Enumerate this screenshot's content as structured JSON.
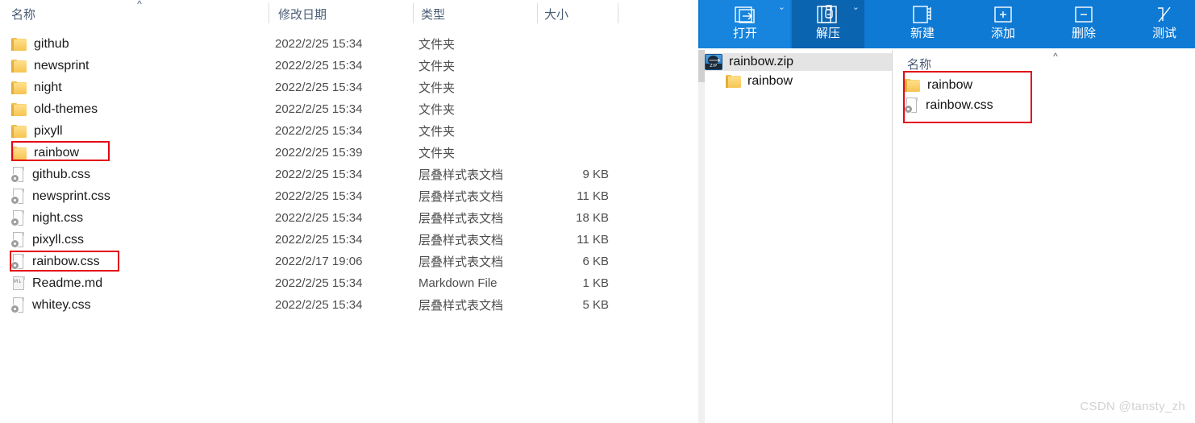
{
  "explorer": {
    "columns": [
      {
        "key": "name",
        "label": "名称"
      },
      {
        "key": "date",
        "label": "修改日期"
      },
      {
        "key": "type",
        "label": "类型"
      },
      {
        "key": "size",
        "label": "大小"
      }
    ],
    "sort_indicator": "chevron-up-icon",
    "rows": [
      {
        "icon": "folder-icon",
        "name": "github",
        "date": "2022/2/25 15:34",
        "type": "文件夹",
        "size": ""
      },
      {
        "icon": "folder-icon",
        "name": "newsprint",
        "date": "2022/2/25 15:34",
        "type": "文件夹",
        "size": ""
      },
      {
        "icon": "folder-icon",
        "name": "night",
        "date": "2022/2/25 15:34",
        "type": "文件夹",
        "size": ""
      },
      {
        "icon": "folder-icon",
        "name": "old-themes",
        "date": "2022/2/25 15:34",
        "type": "文件夹",
        "size": ""
      },
      {
        "icon": "folder-icon",
        "name": "pixyll",
        "date": "2022/2/25 15:34",
        "type": "文件夹",
        "size": ""
      },
      {
        "icon": "folder-icon",
        "name": "rainbow",
        "date": "2022/2/25 15:39",
        "type": "文件夹",
        "size": ""
      },
      {
        "icon": "css-file-icon",
        "name": "github.css",
        "date": "2022/2/25 15:34",
        "type": "层叠样式表文档",
        "size": "9 KB"
      },
      {
        "icon": "css-file-icon",
        "name": "newsprint.css",
        "date": "2022/2/25 15:34",
        "type": "层叠样式表文档",
        "size": "11 KB"
      },
      {
        "icon": "css-file-icon",
        "name": "night.css",
        "date": "2022/2/25 15:34",
        "type": "层叠样式表文档",
        "size": "18 KB"
      },
      {
        "icon": "css-file-icon",
        "name": "pixyll.css",
        "date": "2022/2/25 15:34",
        "type": "层叠样式表文档",
        "size": "11 KB"
      },
      {
        "icon": "css-file-icon",
        "name": "rainbow.css",
        "date": "2022/2/17 19:06",
        "type": "层叠样式表文档",
        "size": "6 KB"
      },
      {
        "icon": "md-file-icon",
        "name": "Readme.md",
        "date": "2022/2/25 15:34",
        "type": "Markdown File",
        "size": "1 KB"
      },
      {
        "icon": "css-file-icon",
        "name": "whitey.css",
        "date": "2022/2/25 15:34",
        "type": "层叠样式表文档",
        "size": "5 KB"
      }
    ],
    "highlights": [
      "rainbow",
      "rainbow.css"
    ]
  },
  "archiver": {
    "toolbar": {
      "background": "#0f7ad4",
      "buttons": [
        {
          "label": "打开",
          "icon": "open-arrow-icon",
          "caret": true,
          "state": "light"
        },
        {
          "label": "解压",
          "icon": "extract-icon",
          "caret": true,
          "state": "dark"
        },
        {
          "label": "新建",
          "icon": "new-archive-icon",
          "caret": false,
          "state": "normal"
        },
        {
          "label": "添加",
          "icon": "plus-icon",
          "caret": false,
          "state": "normal"
        },
        {
          "label": "删除",
          "icon": "minus-icon",
          "caret": false,
          "state": "normal"
        },
        {
          "label": "测试",
          "icon": "test-check-icon",
          "caret": false,
          "state": "normal"
        }
      ]
    },
    "tree": [
      {
        "icon": "zip-archive-icon",
        "label": "rainbow.zip",
        "indent": 0,
        "selected": true
      },
      {
        "icon": "folder-icon",
        "label": "rainbow",
        "indent": 1,
        "selected": false
      }
    ],
    "file_list": {
      "column_label": "名称",
      "sort_indicator": "chevron-up-icon",
      "rows": [
        {
          "icon": "folder-icon",
          "label": "rainbow"
        },
        {
          "icon": "css-file-icon",
          "label": "rainbow.css"
        }
      ]
    },
    "highlight_color": "#e30613"
  },
  "watermark": {
    "text": "CSDN @tansty_zh"
  }
}
